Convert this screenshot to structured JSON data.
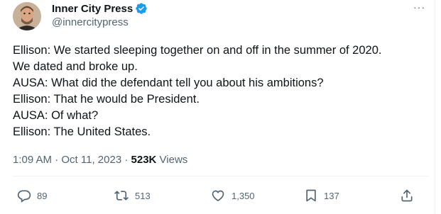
{
  "author": {
    "display_name": "Inner City Press",
    "handle": "@innercitypress",
    "verified": true
  },
  "tweet_lines": [
    "Ellison: We started sleeping together on and off in the summer of 2020.",
    "We dated and broke up.",
    "AUSA: What did the defendant tell you about his ambitions?",
    "Ellison: That he would be President.",
    "AUSA: Of what?",
    "Ellison: The United States."
  ],
  "meta": {
    "time": "1:09 AM",
    "separator": " · ",
    "date": "Oct 11, 2023",
    "views_count": "523K",
    "views_label": " Views"
  },
  "actions": {
    "replies": "89",
    "reposts": "513",
    "likes": "1,350",
    "bookmarks": "137"
  },
  "more_label": "···",
  "colors": {
    "text": "#0f1419",
    "secondary": "#536471",
    "verified": "#1d9bf0",
    "divider": "#eff3f4"
  }
}
